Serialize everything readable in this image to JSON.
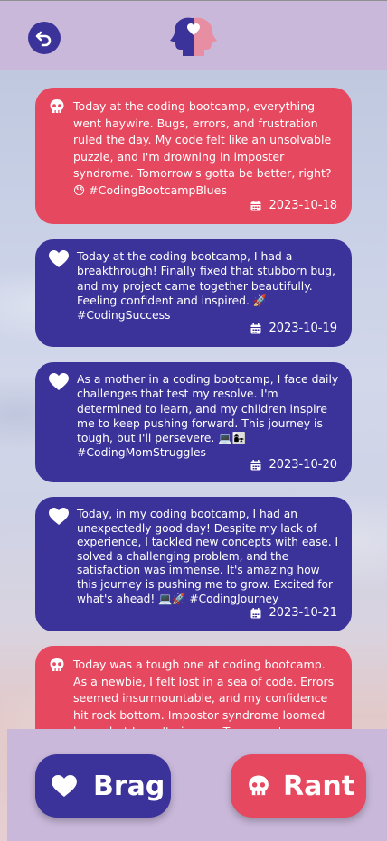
{
  "header": {
    "back_icon": "back-arrow-icon",
    "logo_icon": "two-heads-heart-logo"
  },
  "posts": [
    {
      "type": "rant",
      "icon": "skull-icon",
      "text": "Today at the coding bootcamp, everything went haywire. Bugs, errors, and frustration ruled the day. My code felt like an unsolvable puzzle, and I'm drowning in imposter syndrome. Tomorrow's gotta be better, right? 😓 #CodingBootcampBlues",
      "date": "2023-10-18"
    },
    {
      "type": "brag",
      "icon": "heart-icon",
      "text": "Today at the coding bootcamp, I had a breakthrough! Finally fixed that stubborn bug, and my project came together beautifully. Feeling confident and inspired. 🚀 #CodingSuccess",
      "date": "2023-10-19"
    },
    {
      "type": "brag",
      "icon": "heart-icon",
      "text": "As a mother in a coding bootcamp, I face daily challenges that test my resolve. I'm determined to learn, and my children inspire me to keep pushing forward. This journey is tough, but I'll persevere. 💻👩‍👧 #CodingMomStruggles",
      "date": "2023-10-20"
    },
    {
      "type": "brag",
      "icon": "heart-icon",
      "text": "Today, in my coding bootcamp, I had an unexpectedly good day! Despite my lack of experience, I tackled new concepts with ease. I solved a challenging problem, and the satisfaction was immense. It's amazing how this journey is pushing me to grow. Excited for what's ahead! 💻🚀 #CodingJourney",
      "date": "2023-10-21"
    },
    {
      "type": "rant",
      "icon": "skull-icon",
      "text": "Today was a tough one at coding bootcamp. As a newbie, I felt lost in a sea of code. Errors seemed insurmountable, and my confidence hit rock bottom. Impostor syndrome loomed large, but I won't give up. Tomorrow's a new chance to",
      "date": ""
    }
  ],
  "actions": {
    "brag_label": "Brag",
    "rant_label": "Rant"
  },
  "colors": {
    "brag": "#3b3399",
    "rant": "#e5485f",
    "bar": "#c9b8da"
  }
}
